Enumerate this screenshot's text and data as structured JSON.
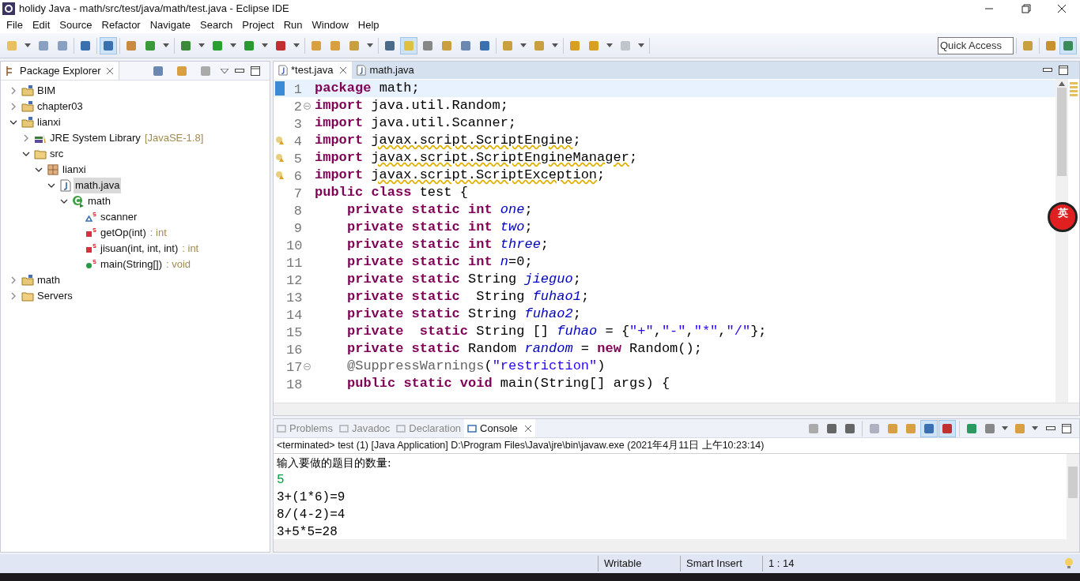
{
  "window": {
    "title": "holidy Java - math/src/test/java/math/test.java - Eclipse IDE"
  },
  "menu": [
    "File",
    "Edit",
    "Source",
    "Refactor",
    "Navigate",
    "Search",
    "Project",
    "Run",
    "Window",
    "Help"
  ],
  "quick_access": {
    "placeholder": "Quick Access"
  },
  "explorer": {
    "title": "Package Explorer",
    "tree": [
      {
        "label": "BIM",
        "kind": "project",
        "expanded": false,
        "selected": false
      },
      {
        "label": "chapter03",
        "kind": "project",
        "expanded": false,
        "selected": false
      },
      {
        "label": "lianxi",
        "kind": "project",
        "expanded": true,
        "selected": false,
        "children": [
          {
            "label": "JRE System Library",
            "suffix": "[JavaSE-1.8]",
            "kind": "library",
            "expanded": false,
            "selected": false
          },
          {
            "label": "src",
            "kind": "folder",
            "expanded": true,
            "selected": false,
            "children": [
              {
                "label": "lianxi",
                "kind": "package",
                "expanded": true,
                "selected": false,
                "children": [
                  {
                    "label": "math.java",
                    "kind": "file",
                    "expanded": true,
                    "selected": true,
                    "children": [
                      {
                        "label": "math",
                        "kind": "class",
                        "expanded": true,
                        "selected": false,
                        "children": [
                          {
                            "label": "scanner",
                            "kind": "field",
                            "selected": false
                          },
                          {
                            "label": "getOp(int)",
                            "suffix": ": int",
                            "kind": "private-method",
                            "selected": false
                          },
                          {
                            "label": "jisuan(int, int, int)",
                            "suffix": ": int",
                            "kind": "private-method",
                            "selected": false
                          },
                          {
                            "label": "main(String[])",
                            "suffix": ": void",
                            "kind": "public-method",
                            "selected": false
                          }
                        ]
                      }
                    ]
                  }
                ]
              }
            ]
          }
        ]
      },
      {
        "label": "math",
        "kind": "project",
        "expanded": false,
        "selected": false
      },
      {
        "label": "Servers",
        "kind": "folder",
        "expanded": false,
        "selected": false
      }
    ]
  },
  "editor_tabs": [
    {
      "label": "*test.java",
      "selected": true
    },
    {
      "label": "math.java",
      "selected": false
    }
  ],
  "code": [
    {
      "number": "1",
      "indented": false,
      "current": true,
      "warning": false,
      "fold": false,
      "tokens": [
        {
          "kind": "kw",
          "text": "package "
        },
        {
          "kind": "plain",
          "text": "math;"
        }
      ]
    },
    {
      "number": "2",
      "indented": false,
      "current": false,
      "warning": false,
      "fold": true,
      "tokens": [
        {
          "kind": "kw",
          "text": "import "
        },
        {
          "kind": "plain",
          "text": "java.util.Random;"
        }
      ]
    },
    {
      "number": "3",
      "indented": false,
      "current": false,
      "warning": false,
      "fold": false,
      "tokens": [
        {
          "kind": "kw",
          "text": "import "
        },
        {
          "kind": "plain",
          "text": "java.util.Scanner;"
        }
      ]
    },
    {
      "number": "4",
      "indented": false,
      "current": false,
      "warning": true,
      "fold": false,
      "tokens": [
        {
          "kind": "kw",
          "text": "import "
        },
        {
          "kind": "squiggle",
          "text": "javax.script.ScriptEngine"
        },
        {
          "kind": "plain",
          "text": ";"
        }
      ]
    },
    {
      "number": "5",
      "indented": false,
      "current": false,
      "warning": true,
      "fold": false,
      "tokens": [
        {
          "kind": "kw",
          "text": "import "
        },
        {
          "kind": "squiggle",
          "text": "javax.script.ScriptEngineManager"
        },
        {
          "kind": "plain",
          "text": ";"
        }
      ]
    },
    {
      "number": "6",
      "indented": false,
      "current": false,
      "warning": true,
      "fold": false,
      "tokens": [
        {
          "kind": "kw",
          "text": "import "
        },
        {
          "kind": "squiggle",
          "text": "javax.script.ScriptException"
        },
        {
          "kind": "plain",
          "text": ";"
        }
      ]
    },
    {
      "number": "7",
      "indented": false,
      "current": false,
      "warning": false,
      "fold": false,
      "tokens": [
        {
          "kind": "kw",
          "text": "public class "
        },
        {
          "kind": "plain",
          "text": "test {"
        }
      ]
    },
    {
      "number": "8",
      "indented": true,
      "current": false,
      "warning": false,
      "fold": false,
      "tokens": [
        {
          "kind": "kw",
          "text": "private static int "
        },
        {
          "kind": "field",
          "text": "one"
        },
        {
          "kind": "plain",
          "text": ";"
        }
      ]
    },
    {
      "number": "9",
      "indented": true,
      "current": false,
      "warning": false,
      "fold": false,
      "tokens": [
        {
          "kind": "kw",
          "text": "private static int "
        },
        {
          "kind": "field",
          "text": "two"
        },
        {
          "kind": "plain",
          "text": ";"
        }
      ]
    },
    {
      "number": "10",
      "indented": true,
      "current": false,
      "warning": false,
      "fold": false,
      "tokens": [
        {
          "kind": "kw",
          "text": "private static int "
        },
        {
          "kind": "field",
          "text": "three"
        },
        {
          "kind": "plain",
          "text": ";"
        }
      ]
    },
    {
      "number": "11",
      "indented": true,
      "current": false,
      "warning": false,
      "fold": false,
      "tokens": [
        {
          "kind": "kw",
          "text": "private static int "
        },
        {
          "kind": "field",
          "text": "n"
        },
        {
          "kind": "plain",
          "text": "=0;"
        }
      ]
    },
    {
      "number": "12",
      "indented": true,
      "current": false,
      "warning": false,
      "fold": false,
      "tokens": [
        {
          "kind": "kw",
          "text": "private static "
        },
        {
          "kind": "plain",
          "text": "String "
        },
        {
          "kind": "field",
          "text": "jieguo"
        },
        {
          "kind": "plain",
          "text": ";"
        }
      ]
    },
    {
      "number": "13",
      "indented": true,
      "current": false,
      "warning": false,
      "fold": false,
      "tokens": [
        {
          "kind": "kw",
          "text": "private static "
        },
        {
          "kind": "plain",
          "text": " String "
        },
        {
          "kind": "field",
          "text": "fuhao1"
        },
        {
          "kind": "plain",
          "text": ";"
        }
      ]
    },
    {
      "number": "14",
      "indented": true,
      "current": false,
      "warning": false,
      "fold": false,
      "tokens": [
        {
          "kind": "kw",
          "text": "private static "
        },
        {
          "kind": "plain",
          "text": "String "
        },
        {
          "kind": "field",
          "text": "fuhao2"
        },
        {
          "kind": "plain",
          "text": ";"
        }
      ]
    },
    {
      "number": "15",
      "indented": true,
      "current": false,
      "warning": false,
      "fold": false,
      "tokens": [
        {
          "kind": "kw",
          "text": "private  static "
        },
        {
          "kind": "plain",
          "text": "String [] "
        },
        {
          "kind": "field",
          "text": "fuhao"
        },
        {
          "kind": "plain",
          "text": " = {"
        },
        {
          "kind": "str",
          "text": "\"+\""
        },
        {
          "kind": "plain",
          "text": ","
        },
        {
          "kind": "str",
          "text": "\"-\""
        },
        {
          "kind": "plain",
          "text": ","
        },
        {
          "kind": "str",
          "text": "\"*\""
        },
        {
          "kind": "plain",
          "text": ","
        },
        {
          "kind": "str",
          "text": "\"/\""
        },
        {
          "kind": "plain",
          "text": "};"
        }
      ]
    },
    {
      "number": "16",
      "indented": true,
      "current": false,
      "warning": false,
      "fold": false,
      "tokens": [
        {
          "kind": "kw",
          "text": "private static "
        },
        {
          "kind": "plain",
          "text": "Random "
        },
        {
          "kind": "field",
          "text": "random"
        },
        {
          "kind": "plain",
          "text": " = "
        },
        {
          "kind": "kw",
          "text": "new "
        },
        {
          "kind": "plain",
          "text": "Random();"
        }
      ]
    },
    {
      "number": "17",
      "indented": true,
      "current": false,
      "warning": false,
      "fold": true,
      "tokens": [
        {
          "kind": "annot",
          "text": "@SuppressWarnings"
        },
        {
          "kind": "plain",
          "text": "("
        },
        {
          "kind": "str",
          "text": "\"restriction\""
        },
        {
          "kind": "plain",
          "text": ")"
        }
      ]
    },
    {
      "number": "18",
      "indented": true,
      "current": false,
      "warning": false,
      "fold": false,
      "tokens": [
        {
          "kind": "kw",
          "text": "public static void "
        },
        {
          "kind": "plain",
          "text": "main(String[] args) {"
        }
      ]
    }
  ],
  "ime_badge": "英",
  "bottom_tabs": [
    {
      "label": "Problems",
      "selected": false
    },
    {
      "label": "Javadoc",
      "selected": false
    },
    {
      "label": "Declaration",
      "selected": false
    },
    {
      "label": "Console",
      "selected": true
    }
  ],
  "console": {
    "header": "<terminated> test (1) [Java Application] D:\\Program Files\\Java\\jre\\bin\\javaw.exe (2021年4月11日 上午10:23:14)",
    "lines": [
      {
        "kind": "output",
        "text": "输入要做的题目的数量:"
      },
      {
        "kind": "input",
        "text": "5"
      },
      {
        "kind": "output",
        "text": "3+(1*6)=9"
      },
      {
        "kind": "output",
        "text": "8/(4-2)=4"
      },
      {
        "kind": "output",
        "text": "3+5*5=28"
      }
    ]
  },
  "status_bar": [
    "Writable",
    "Smart Insert",
    "1 : 14"
  ]
}
